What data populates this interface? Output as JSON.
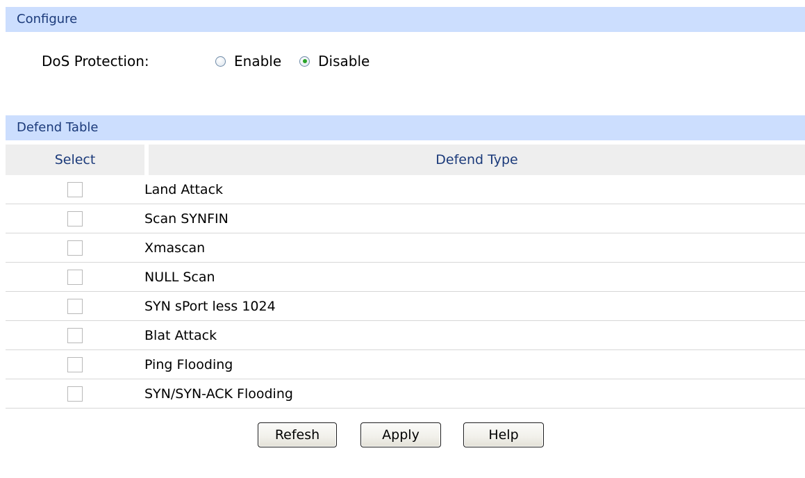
{
  "configure": {
    "title": "Configure",
    "dos_label": "DoS Protection:",
    "options": [
      {
        "label": "Enable",
        "checked": false
      },
      {
        "label": "Disable",
        "checked": true
      }
    ]
  },
  "defend_table": {
    "title": "Defend Table",
    "headers": {
      "select": "Select",
      "type": "Defend Type"
    },
    "rows": [
      {
        "type": "Land Attack",
        "selected": false
      },
      {
        "type": "Scan SYNFIN",
        "selected": false
      },
      {
        "type": "Xmascan",
        "selected": false
      },
      {
        "type": "NULL Scan",
        "selected": false
      },
      {
        "type": "SYN sPort less 1024",
        "selected": false
      },
      {
        "type": "Blat Attack",
        "selected": false
      },
      {
        "type": "Ping Flooding",
        "selected": false
      },
      {
        "type": "SYN/SYN-ACK Flooding",
        "selected": false
      }
    ]
  },
  "buttons": {
    "refresh": "Refesh",
    "apply": "Apply",
    "help": "Help"
  },
  "colors": {
    "section_header_bg": "#ccdefe",
    "section_header_text": "#1b3a7a",
    "table_header_bg": "#eeeeee",
    "radio_dot": "#29a329"
  }
}
